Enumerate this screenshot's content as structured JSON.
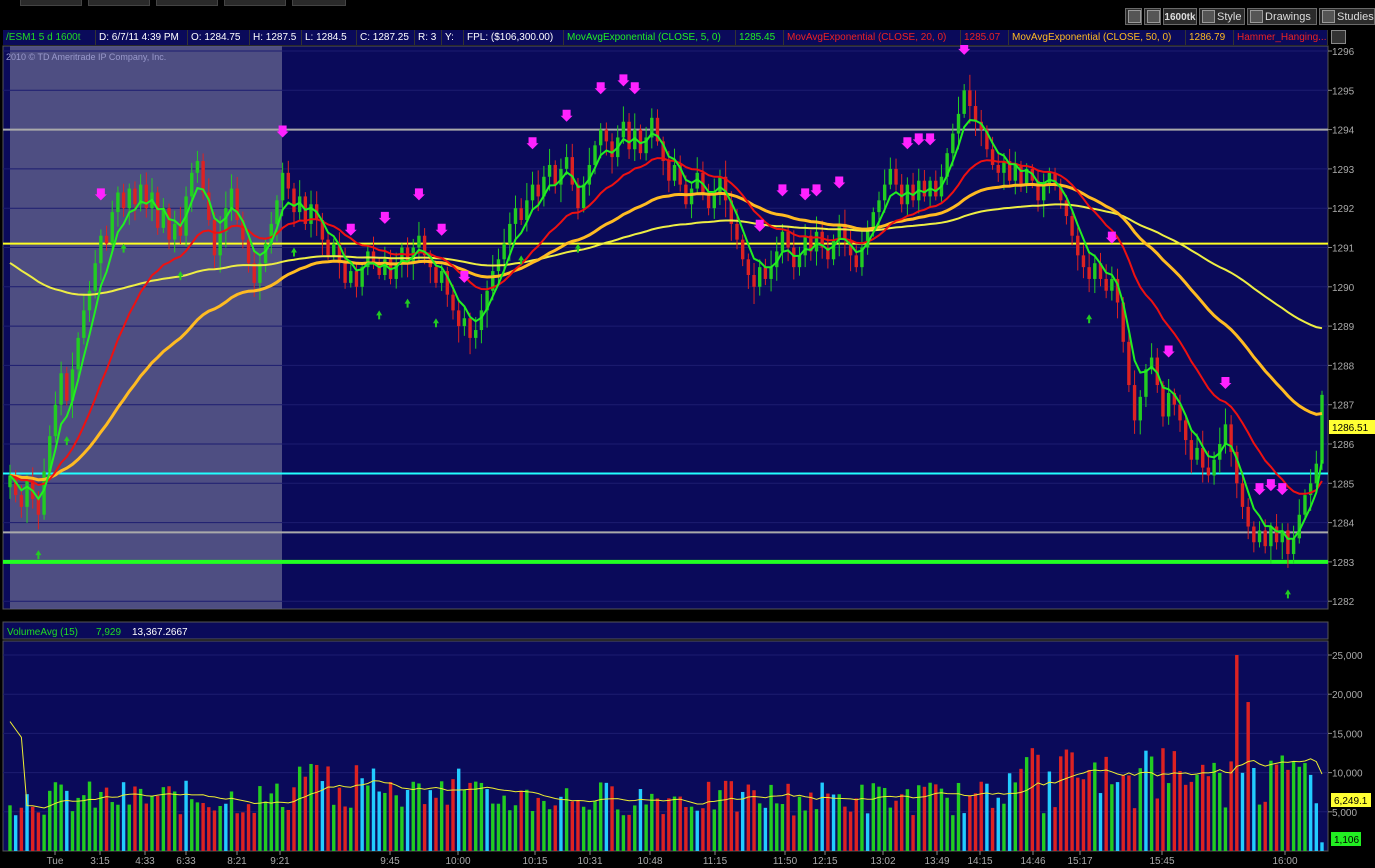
{
  "toolbar": {
    "interval": "1600tk",
    "style_label": "Style",
    "drawings_label": "Drawings",
    "studies_label": "Studies"
  },
  "header": {
    "symbol": "/ESM1 5 d 1600t",
    "date": "D: 6/7/11 4:39 PM",
    "open": "O: 1284.75",
    "high": "H: 1287.5",
    "low": "L: 1284.5",
    "close": "C: 1287.25",
    "range": "R: 3",
    "y": "Y:",
    "fpl": "FPL: ($106,300.00)",
    "ma5_label": "MovAvgExponential (CLOSE, 5, 0)",
    "ma5_value": "1285.45",
    "ma20_label": "MovAvgExponential (CLOSE, 20, 0)",
    "ma20_value": "1285.07",
    "ma50_label": "MovAvgExponential (CLOSE, 50, 0)",
    "ma50_value": "1286.79",
    "hammer_label": "Hammer_Hanging..."
  },
  "copyright": "2010 © TD Ameritrade IP Company, Inc.",
  "price_axis": {
    "ticks": [
      "1296",
      "1295",
      "1294",
      "1293",
      "1292",
      "1291",
      "1290",
      "1289",
      "1288",
      "1287",
      "1286",
      "1285",
      "1284",
      "1283",
      "1282"
    ],
    "current_price": "1286.51"
  },
  "volume_header": {
    "label": "VolumeAvg (15)",
    "value1": "7,929",
    "value2": "13,367.2667"
  },
  "volume_axis": {
    "ticks": [
      "25,000",
      "20,000",
      "15,000",
      "10,000",
      "5,000"
    ],
    "avg_badge": "6,249.1",
    "cur_badge": "1,106"
  },
  "time_axis": [
    "Tue",
    "3:15",
    "4:33",
    "6:33",
    "8:21",
    "9:21",
    "9:45",
    "10:00",
    "10:15",
    "10:31",
    "10:48",
    "11:15",
    "11:50",
    "12:15",
    "13:02",
    "13:49",
    "14:15",
    "14:46",
    "15:17",
    "15:45",
    "16:00"
  ],
  "colors": {
    "panel_bg": "#0a0a5a",
    "premarket_bg": "#5a5a8a",
    "up": "#22cc22",
    "down": "#dd2222",
    "ma5": "#22ee22",
    "ma20": "#ee1111",
    "ma50": "#ffbb22",
    "ma_slow": "#eeee44",
    "signal": "#ff22ff",
    "line_yellow": "#ffff22",
    "line_cyan": "#22ffff",
    "line_green": "#22ff22",
    "line_gray": "#aaaaaa",
    "vol_cyan": "#22ccff"
  },
  "chart_data": {
    "type": "candlestick",
    "y_axis": {
      "min": 1282,
      "max": 1296
    },
    "horizontal_lines": [
      {
        "price": 1294.0,
        "color": "gray"
      },
      {
        "price": 1291.1,
        "color": "yellow"
      },
      {
        "price": 1285.25,
        "color": "cyan"
      },
      {
        "price": 1283.75,
        "color": "gray"
      },
      {
        "price": 1283.0,
        "color": "green"
      }
    ],
    "closes": [
      1285.2,
      1284.7,
      1284.4,
      1285.1,
      1284.6,
      1284.2,
      1285.3,
      1286.2,
      1287.0,
      1287.8,
      1287.1,
      1287.9,
      1288.7,
      1289.4,
      1289.9,
      1290.6,
      1291.3,
      1291.1,
      1291.9,
      1292.4,
      1292.0,
      1292.5,
      1292.1,
      1292.6,
      1292.0,
      1292.4,
      1291.5,
      1292.0,
      1291.2,
      1291.6,
      1291.3,
      1292.3,
      1292.9,
      1293.2,
      1292.4,
      1291.7,
      1290.8,
      1291.4,
      1292.0,
      1292.5,
      1291.7,
      1291.2,
      1290.6,
      1290.1,
      1290.6,
      1291.1,
      1291.6,
      1292.2,
      1292.9,
      1292.5,
      1291.9,
      1292.3,
      1291.6,
      1292.1,
      1291.7,
      1291.2,
      1290.8,
      1291.1,
      1290.6,
      1290.1,
      1290.4,
      1290.0,
      1290.5,
      1290.9,
      1290.6,
      1290.3,
      1290.7,
      1290.2,
      1290.6,
      1291.0,
      1290.6,
      1291.0,
      1291.3,
      1290.8,
      1290.5,
      1290.1,
      1290.4,
      1289.8,
      1289.4,
      1289.0,
      1289.2,
      1288.7,
      1288.9,
      1289.4,
      1289.9,
      1290.4,
      1290.7,
      1291.1,
      1291.6,
      1292.0,
      1291.7,
      1292.2,
      1292.6,
      1292.3,
      1292.8,
      1293.1,
      1292.6,
      1293.0,
      1293.3,
      1292.6,
      1292.0,
      1292.6,
      1293.1,
      1293.6,
      1294.0,
      1293.7,
      1293.3,
      1293.8,
      1294.2,
      1293.5,
      1294.0,
      1293.4,
      1293.8,
      1294.3,
      1293.7,
      1293.2,
      1292.7,
      1293.1,
      1292.6,
      1292.1,
      1292.5,
      1292.9,
      1292.4,
      1292.0,
      1292.4,
      1292.8,
      1292.2,
      1291.6,
      1291.2,
      1290.7,
      1290.3,
      1290.0,
      1290.5,
      1290.2,
      1290.5,
      1290.9,
      1291.4,
      1291.0,
      1290.5,
      1290.8,
      1291.3,
      1290.9,
      1291.4,
      1291.0,
      1290.7,
      1291.2,
      1291.6,
      1291.2,
      1290.8,
      1290.5,
      1291.0,
      1291.5,
      1291.9,
      1292.2,
      1292.6,
      1293.0,
      1292.6,
      1292.1,
      1292.6,
      1292.2,
      1292.7,
      1292.3,
      1292.7,
      1292.3,
      1292.8,
      1293.4,
      1293.9,
      1294.4,
      1295.0,
      1294.6,
      1294.2,
      1294.0,
      1293.5,
      1293.1,
      1292.9,
      1293.2,
      1292.7,
      1293.1,
      1292.6,
      1293.0,
      1292.7,
      1292.2,
      1292.6,
      1292.9,
      1292.6,
      1292.2,
      1291.8,
      1291.3,
      1290.8,
      1290.5,
      1290.2,
      1290.6,
      1290.2,
      1289.9,
      1290.2,
      1289.6,
      1288.6,
      1287.5,
      1286.6,
      1287.2,
      1287.9,
      1288.2,
      1287.5,
      1286.7,
      1287.3,
      1287.0,
      1286.6,
      1286.1,
      1285.6,
      1285.9,
      1285.4,
      1285.2,
      1285.6,
      1286.0,
      1286.5,
      1285.8,
      1285.0,
      1284.4,
      1283.9,
      1283.5,
      1283.8,
      1283.4,
      1283.9,
      1283.5,
      1283.8,
      1283.2,
      1283.6,
      1284.2,
      1284.7,
      1285.0,
      1285.5,
      1287.25
    ]
  }
}
